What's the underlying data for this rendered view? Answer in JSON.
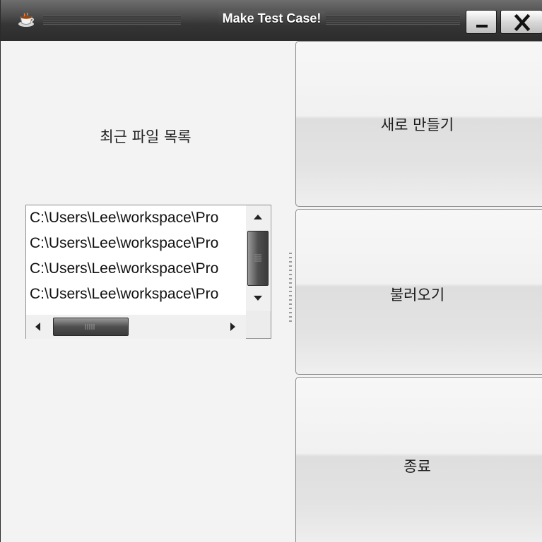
{
  "window": {
    "title": "Make Test Case!",
    "app_icon": "coffee-cup-icon",
    "minimize_icon": "minimize-icon",
    "close_icon": "close-icon"
  },
  "recent": {
    "label": "최근 파일 목록",
    "items": [
      "C:\\Users\\Lee\\workspace\\Pro",
      "C:\\Users\\Lee\\workspace\\Pro",
      "C:\\Users\\Lee\\workspace\\Pro",
      "C:\\Users\\Lee\\workspace\\Pro"
    ]
  },
  "buttons": {
    "new": "새로 만들기",
    "load": "불러오기",
    "exit": "종료"
  }
}
